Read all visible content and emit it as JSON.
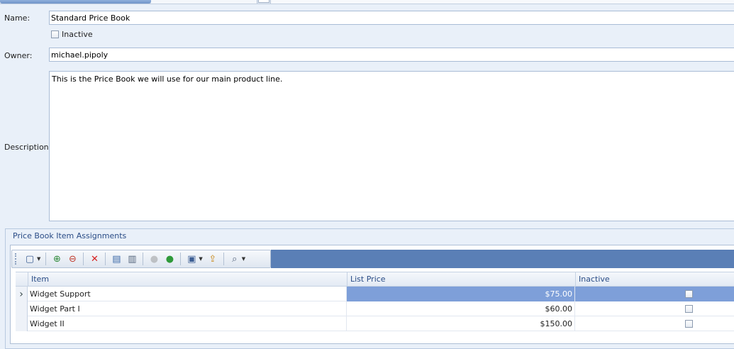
{
  "form": {
    "name_label": "Name:",
    "name_value": "Standard Price Book",
    "inactive_label": "Inactive",
    "inactive_checked": false,
    "owner_label": "Owner:",
    "owner_value": "michael.pipoly",
    "description_label": "Description:",
    "description_value": "This is the Price Book we will use for our main product line."
  },
  "assignments": {
    "title": "Price Book Item Assignments",
    "toolbar": [
      {
        "icon": "new-document-icon",
        "glyph": "▢",
        "dropdown": true,
        "enabled": true
      },
      {
        "icon": "add-item-icon",
        "glyph": "⊕",
        "enabled": true
      },
      {
        "icon": "remove-item-icon",
        "glyph": "⊖",
        "enabled": true
      },
      {
        "icon": "delete-icon",
        "glyph": "✕",
        "enabled": true
      },
      {
        "icon": "grid-view-icon",
        "glyph": "▤",
        "enabled": true
      },
      {
        "icon": "print-preview-icon",
        "glyph": "▥",
        "enabled": true
      },
      {
        "icon": "move-up-icon",
        "glyph": "●",
        "enabled": false
      },
      {
        "icon": "move-down-icon",
        "glyph": "●",
        "enabled": true
      },
      {
        "icon": "save-icon",
        "glyph": "▣",
        "dropdown": true,
        "enabled": true
      },
      {
        "icon": "export-icon",
        "glyph": "⇪",
        "enabled": true
      },
      {
        "icon": "search-icon",
        "glyph": "⌕",
        "dropdown": true,
        "enabled": true
      }
    ],
    "columns": {
      "item": "Item",
      "list_price": "List Price",
      "inactive": "Inactive"
    },
    "rows": [
      {
        "item": "Widget Support",
        "list_price": "$75.00",
        "inactive": false,
        "selected": true
      },
      {
        "item": "Widget Part I",
        "list_price": "$60.00",
        "inactive": false,
        "selected": false
      },
      {
        "item": "Widget II",
        "list_price": "$150.00",
        "inactive": false,
        "selected": false
      }
    ]
  },
  "colors": {
    "background": "#e9f0f9",
    "accent": "#5a7fb6",
    "selection": "#7e9fd9",
    "header_text": "#2a4c86"
  }
}
